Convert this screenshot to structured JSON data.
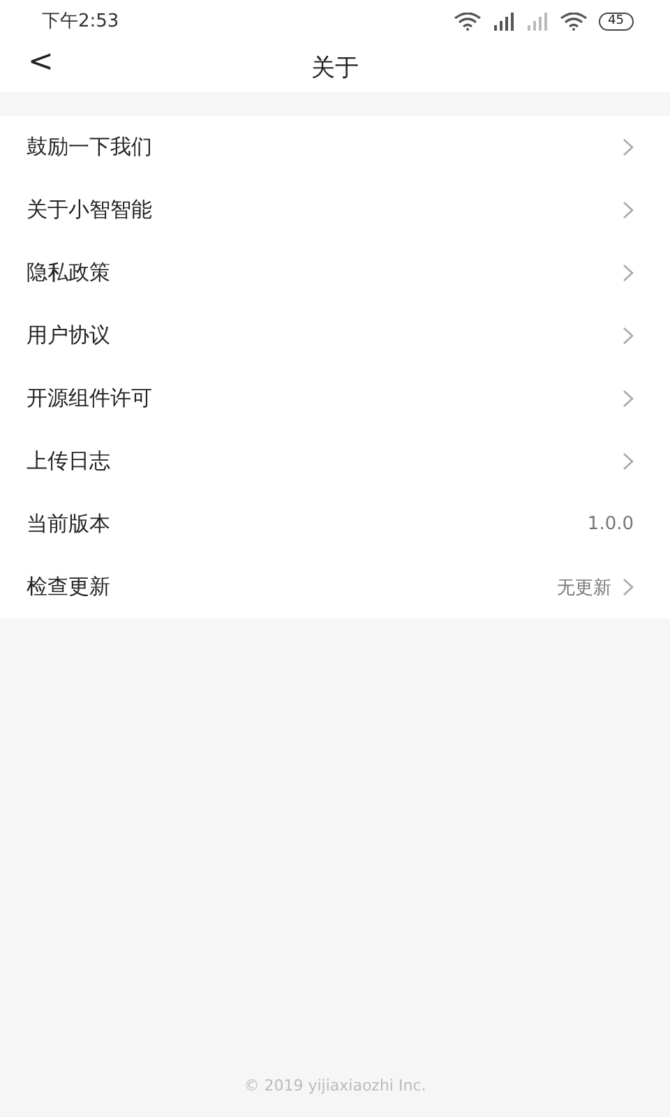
{
  "status_bar": {
    "time": "下午2:53",
    "battery": "45"
  },
  "header": {
    "back": "<",
    "title": "关于"
  },
  "items": [
    {
      "label": "鼓励一下我们",
      "kind": "link"
    },
    {
      "label": "关于小智智能",
      "kind": "link"
    },
    {
      "label": "隐私政策",
      "kind": "link"
    },
    {
      "label": "用户协议",
      "kind": "link"
    },
    {
      "label": "开源组件许可",
      "kind": "link"
    },
    {
      "label": "上传日志",
      "kind": "link"
    },
    {
      "label": "当前版本",
      "kind": "value",
      "value": "1.0.0"
    },
    {
      "label": "检查更新",
      "kind": "value_link",
      "value": "无更新"
    }
  ],
  "footer": "© 2019 yijiaxiaozhi Inc."
}
